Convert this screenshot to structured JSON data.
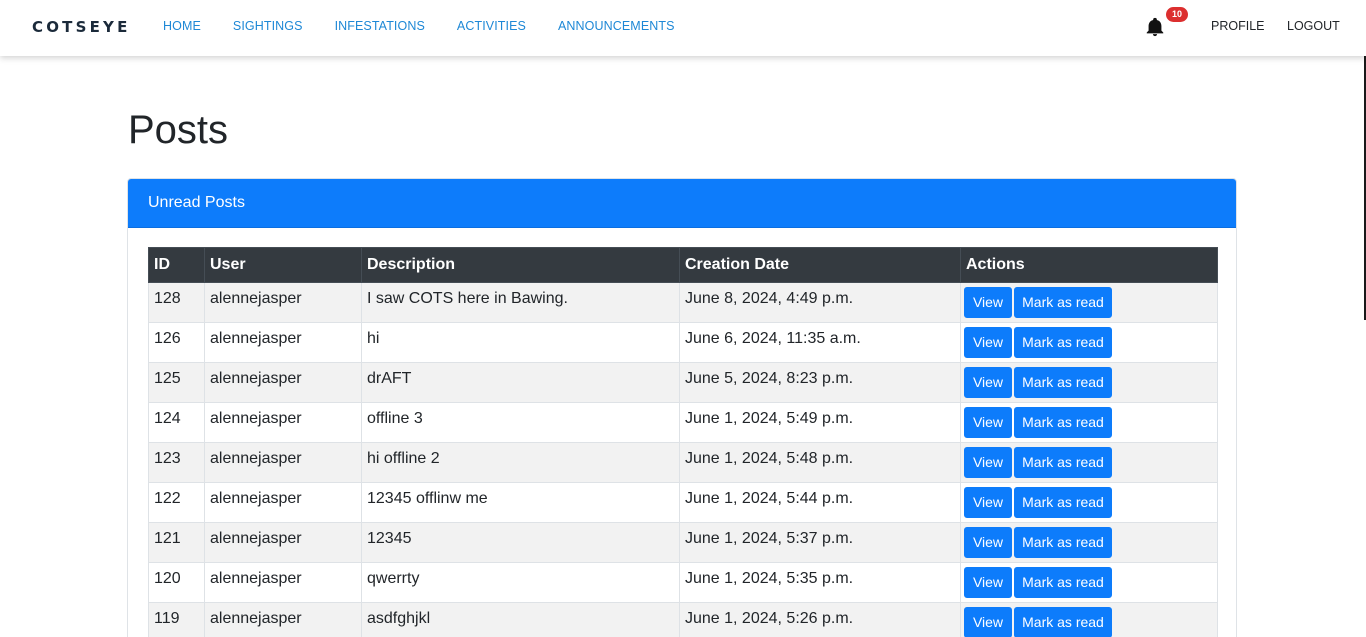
{
  "brand": {
    "text": "COTSEYE"
  },
  "nav": {
    "links": [
      "HOME",
      "SIGHTINGS",
      "INFESTATIONS",
      "ACTIVITIES",
      "ANNOUNCEMENTS"
    ],
    "notification_count": "10",
    "profile": "PROFILE",
    "logout": "LOGOUT"
  },
  "page": {
    "title": "Posts"
  },
  "card": {
    "header": "Unread Posts"
  },
  "table": {
    "headers": [
      "ID",
      "User",
      "Description",
      "Creation Date",
      "Actions"
    ],
    "view_label": "View",
    "mark_label": "Mark as read",
    "rows": [
      {
        "id": "128",
        "user": "alennejasper",
        "description": "I saw COTS here in Bawing.",
        "date": "June 8, 2024, 4:49 p.m."
      },
      {
        "id": "126",
        "user": "alennejasper",
        "description": "hi",
        "date": "June 6, 2024, 11:35 a.m."
      },
      {
        "id": "125",
        "user": "alennejasper",
        "description": "drAFT",
        "date": "June 5, 2024, 8:23 p.m."
      },
      {
        "id": "124",
        "user": "alennejasper",
        "description": "offline 3",
        "date": "June 1, 2024, 5:49 p.m."
      },
      {
        "id": "123",
        "user": "alennejasper",
        "description": "hi offline 2",
        "date": "June 1, 2024, 5:48 p.m."
      },
      {
        "id": "122",
        "user": "alennejasper",
        "description": "12345 offlinw me",
        "date": "June 1, 2024, 5:44 p.m."
      },
      {
        "id": "121",
        "user": "alennejasper",
        "description": "12345",
        "date": "June 1, 2024, 5:37 p.m."
      },
      {
        "id": "120",
        "user": "alennejasper",
        "description": "qwerrty",
        "date": "June 1, 2024, 5:35 p.m."
      },
      {
        "id": "119",
        "user": "alennejasper",
        "description": "asdfghjkl",
        "date": "June 1, 2024, 5:26 p.m."
      }
    ]
  },
  "colors": {
    "primary": "#0d7cfb",
    "nav_link": "#1e88d6",
    "table_head": "#343a40",
    "badge": "#dc2f2f"
  },
  "icons": {
    "notification": "bell-icon"
  }
}
